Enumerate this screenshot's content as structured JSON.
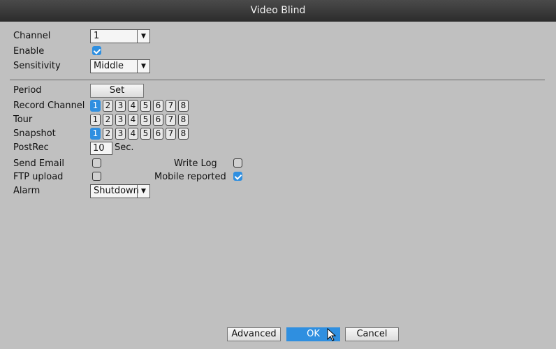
{
  "window": {
    "title": "Video Blind"
  },
  "fields": {
    "channel": {
      "label": "Channel",
      "value": "1"
    },
    "enable": {
      "label": "Enable",
      "checked": true
    },
    "sensitivity": {
      "label": "Sensitivity",
      "value": "Middle"
    },
    "period": {
      "label": "Period",
      "button": "Set"
    },
    "record_channel": {
      "label": "Record Channel",
      "channels": [
        "1",
        "2",
        "3",
        "4",
        "5",
        "6",
        "7",
        "8"
      ],
      "selected": [
        1
      ]
    },
    "tour": {
      "label": "Tour",
      "channels": [
        "1",
        "2",
        "3",
        "4",
        "5",
        "6",
        "7",
        "8"
      ],
      "selected": []
    },
    "snapshot": {
      "label": "Snapshot",
      "channels": [
        "1",
        "2",
        "3",
        "4",
        "5",
        "6",
        "7",
        "8"
      ],
      "selected": [
        1
      ]
    },
    "postrec": {
      "label": "PostRec",
      "value": "10",
      "unit": "Sec."
    },
    "send_email": {
      "label": "Send Email",
      "checked": false
    },
    "write_log": {
      "label": "Write Log",
      "checked": false
    },
    "ftp_upload": {
      "label": "FTP upload",
      "checked": false
    },
    "mobile_reported": {
      "label": "Mobile reported",
      "checked": true
    },
    "alarm": {
      "label": "Alarm",
      "value": "Shutdown"
    }
  },
  "buttons": {
    "advanced": "Advanced",
    "ok": "OK",
    "cancel": "Cancel"
  },
  "colors": {
    "accent": "#2f8fe0",
    "panel": "#c0c0c0",
    "titlebar": "#333333"
  }
}
